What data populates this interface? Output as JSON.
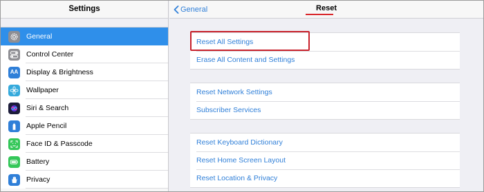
{
  "sidebar": {
    "title": "Settings",
    "items": [
      {
        "label": "General",
        "icon": "gear-icon",
        "color": "#8e8e93"
      },
      {
        "label": "Control Center",
        "icon": "toggles-icon",
        "color": "#8e8e93"
      },
      {
        "label": "Display & Brightness",
        "icon": "text-size-icon",
        "glyph": "AA",
        "color": "#2f7fd8"
      },
      {
        "label": "Wallpaper",
        "icon": "flower-icon",
        "color": "#35aadc"
      },
      {
        "label": "Siri & Search",
        "icon": "siri-icon",
        "color": "#1c1c3a"
      },
      {
        "label": "Apple Pencil",
        "icon": "pencil-icon",
        "color": "#2f7fd8"
      },
      {
        "label": "Face ID & Passcode",
        "icon": "face-id-icon",
        "color": "#34c759"
      },
      {
        "label": "Battery",
        "icon": "battery-icon",
        "color": "#34c759"
      },
      {
        "label": "Privacy",
        "icon": "hand-icon",
        "color": "#2f7fd8"
      }
    ],
    "active_index": 0
  },
  "header": {
    "back_label": "General",
    "title": "Reset"
  },
  "groups": [
    {
      "rows": [
        "Reset All Settings",
        "Erase All Content and Settings"
      ]
    },
    {
      "rows": [
        "Reset Network Settings",
        "Subscriber Services"
      ]
    },
    {
      "rows": [
        "Reset Keyboard Dictionary",
        "Reset Home Screen Layout",
        "Reset Location & Privacy"
      ]
    }
  ],
  "colors": {
    "accent": "#2f7fd8",
    "selection": "#2f8fea",
    "highlight": "#c8202a"
  }
}
